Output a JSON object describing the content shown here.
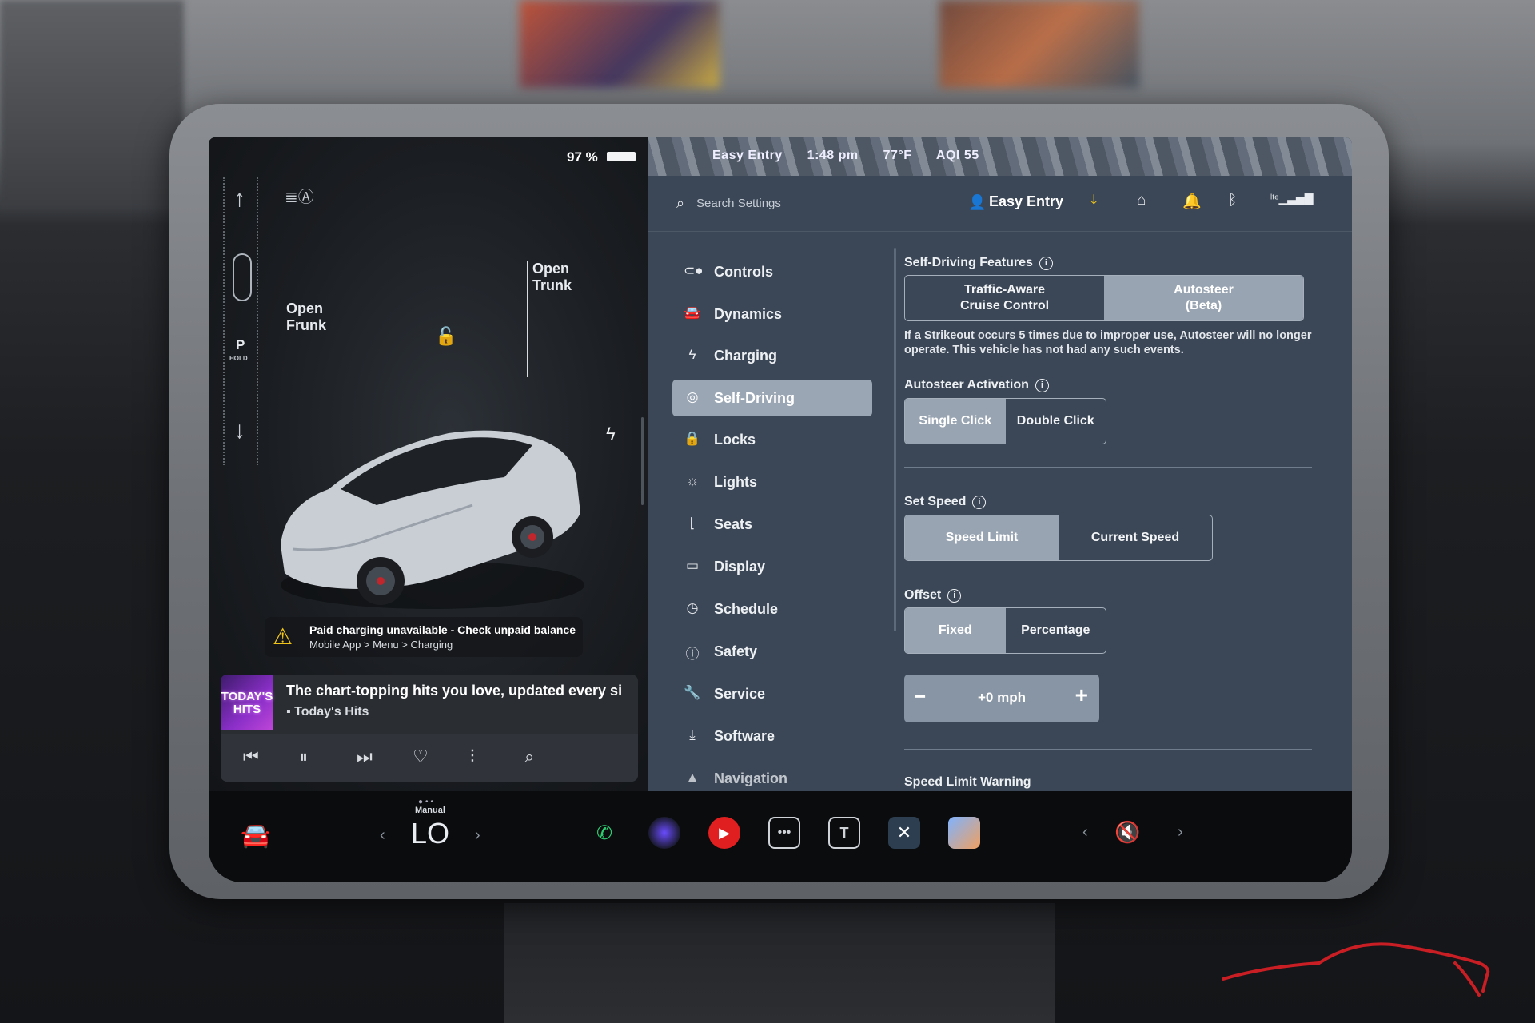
{
  "status": {
    "battery_percent": "97 %",
    "battery_level": 0.97
  },
  "left_panel": {
    "gear": {
      "park": "P",
      "hold": "HOLD"
    },
    "labels": {
      "open_frunk": "Open\nFrunk",
      "open_trunk": "Open\nTrunk"
    },
    "alert": {
      "title": "Paid charging unavailable - Check unpaid balance",
      "subtitle": "Mobile App > Menu > Charging"
    },
    "media": {
      "art_text": "TODAY'S HITS",
      "title": "The chart-topping hits you love, updated every si",
      "source": "Today's Hits"
    }
  },
  "map_strip": {
    "profile": "Easy Entry",
    "time": "1:48 pm",
    "temp": "77°F",
    "aqi": "AQI 55"
  },
  "settings": {
    "search": {
      "placeholder": "Search Settings"
    },
    "profile_name": "Easy Entry",
    "nav": [
      {
        "label": "Controls",
        "icon": "toggle-icon"
      },
      {
        "label": "Dynamics",
        "icon": "car-icon"
      },
      {
        "label": "Charging",
        "icon": "bolt-icon"
      },
      {
        "label": "Self-Driving",
        "icon": "steering-wheel-icon",
        "active": true
      },
      {
        "label": "Locks",
        "icon": "lock-icon"
      },
      {
        "label": "Lights",
        "icon": "sun-icon"
      },
      {
        "label": "Seats",
        "icon": "seat-icon"
      },
      {
        "label": "Display",
        "icon": "display-icon"
      },
      {
        "label": "Schedule",
        "icon": "clock-icon"
      },
      {
        "label": "Safety",
        "icon": "alert-circle-icon"
      },
      {
        "label": "Service",
        "icon": "wrench-icon"
      },
      {
        "label": "Software",
        "icon": "download-icon"
      },
      {
        "label": "Navigation",
        "icon": "navigation-arrow-icon"
      }
    ],
    "self_driving": {
      "features_title": "Self-Driving Features",
      "features_options": [
        "Traffic-Aware\nCruise Control",
        "Autosteer\n(Beta)"
      ],
      "features_selected": "Autosteer\n(Beta)",
      "strikeout_note": "If a Strikeout occurs 5 times due to improper use, Autosteer will no longer operate. This vehicle has not had any such events.",
      "activation_title": "Autosteer Activation",
      "activation_options": [
        "Single Click",
        "Double Click"
      ],
      "activation_selected": "Single Click",
      "set_speed_title": "Set Speed",
      "set_speed_options": [
        "Speed Limit",
        "Current Speed"
      ],
      "set_speed_selected": "Speed Limit",
      "offset_title": "Offset",
      "offset_options": [
        "Fixed",
        "Percentage"
      ],
      "offset_selected": "Fixed",
      "offset_value": "+0 mph",
      "speed_limit_warning_title": "Speed Limit Warning"
    }
  },
  "dock": {
    "climate_mode": "Manual",
    "climate_value": "LO",
    "apps": [
      "phone-icon",
      "camera-icon",
      "media-player-icon",
      "more-icon",
      "toybox-icon",
      "shuffle-icon",
      "photo-app-icon"
    ],
    "volume_state": "muted"
  },
  "colors": {
    "accent_selected": "#98a4b2",
    "alert_yellow": "#f0c419",
    "settings_bg": "#3b4756"
  }
}
